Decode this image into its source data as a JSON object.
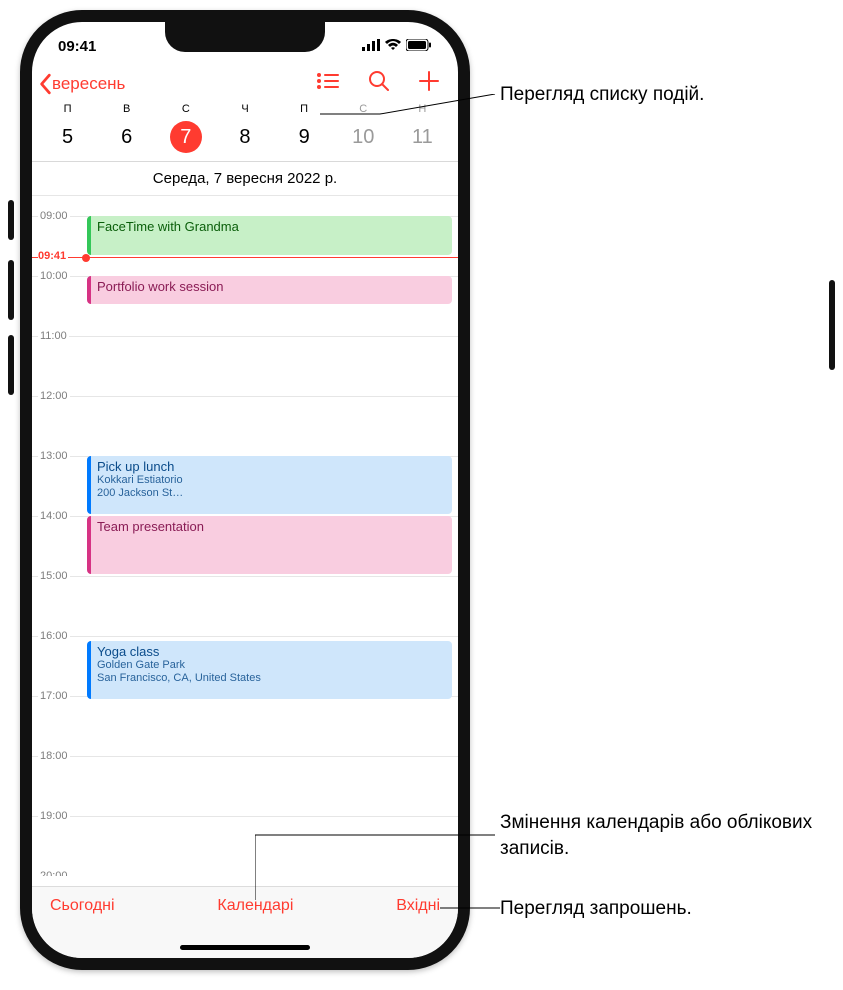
{
  "status": {
    "time": "09:41"
  },
  "nav": {
    "back_label": "вересень"
  },
  "week": {
    "days": [
      {
        "lbl": "П",
        "num": "5"
      },
      {
        "lbl": "В",
        "num": "6"
      },
      {
        "lbl": "С",
        "num": "7"
      },
      {
        "lbl": "Ч",
        "num": "8"
      },
      {
        "lbl": "П",
        "num": "9"
      },
      {
        "lbl": "С",
        "num": "10"
      },
      {
        "lbl": "Н",
        "num": "11"
      }
    ],
    "selected_index": 2
  },
  "date_label": "Середа, 7 вересня 2022 р.",
  "hours": [
    "09:00",
    "10:00",
    "11:00",
    "12:00",
    "13:00",
    "14:00",
    "15:00",
    "16:00",
    "17:00",
    "18:00",
    "19:00",
    "20:00"
  ],
  "now": "09:41",
  "events": [
    {
      "title": "FaceTime with Grandma",
      "start": "09:00",
      "end": "09:41",
      "color": "green"
    },
    {
      "title": "Portfolio work session",
      "start": "10:00",
      "end": "10:30",
      "color": "pink"
    },
    {
      "title": "Pick up lunch",
      "sub1": "Kokkari Estiatorio",
      "sub2": "200 Jackson St…",
      "start": "13:00",
      "end": "14:00",
      "color": "blue"
    },
    {
      "title": "Team presentation",
      "start": "14:00",
      "end": "15:00",
      "color": "pink"
    },
    {
      "title": "Yoga class",
      "sub1": "Golden Gate Park",
      "sub2": "San Francisco, CA, United States",
      "start": "16:05",
      "end": "17:05",
      "color": "blue"
    }
  ],
  "toolbar": {
    "today": "Сьогодні",
    "calendars": "Календарі",
    "inbox": "Вхідні"
  },
  "callouts": {
    "list": "Перегляд списку подій.",
    "calendars": "Змінення календарів або облікових записів.",
    "inbox": "Перегляд запрошень."
  }
}
